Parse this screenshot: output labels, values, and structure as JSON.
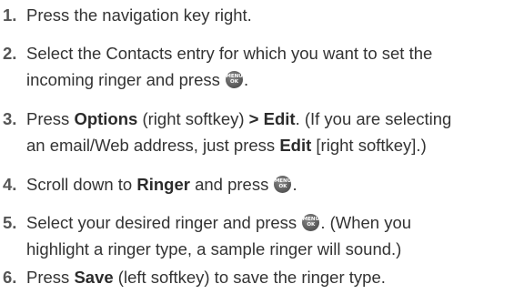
{
  "steps": [
    {
      "num": "1.",
      "text": "Press the navigation key right."
    },
    {
      "num": "2.",
      "line1": "Select the Contacts entry for which you want to set the",
      "line2_a": "incoming ringer and press",
      "line2_b": "."
    },
    {
      "num": "3.",
      "l1_a": "Press ",
      "l1_bold1": "Options",
      "l1_b": " (right softkey) ",
      "l1_bold2": "> Edit",
      "l1_c": ". (If you are selecting",
      "l2_a": "an email/Web address, just press ",
      "l2_bold": "Edit",
      "l2_b": " [right softkey].)"
    },
    {
      "num": "4.",
      "a": "Scroll down to ",
      "bold": "Ringer",
      "b": " and press",
      "c": "."
    },
    {
      "num": "5.",
      "line1_a": "Select your desired ringer and press",
      "line1_b": ". (When you",
      "line2": "highlight a ringer type, a sample ringer will sound.)"
    },
    {
      "num": "6.",
      "a": "Press ",
      "bold": "Save",
      "b": " (left softkey) to save the ringer type."
    }
  ],
  "menu_key": {
    "icon": "menu-ok-key-icon",
    "top_label": "MENU",
    "bottom_label": "OK"
  }
}
